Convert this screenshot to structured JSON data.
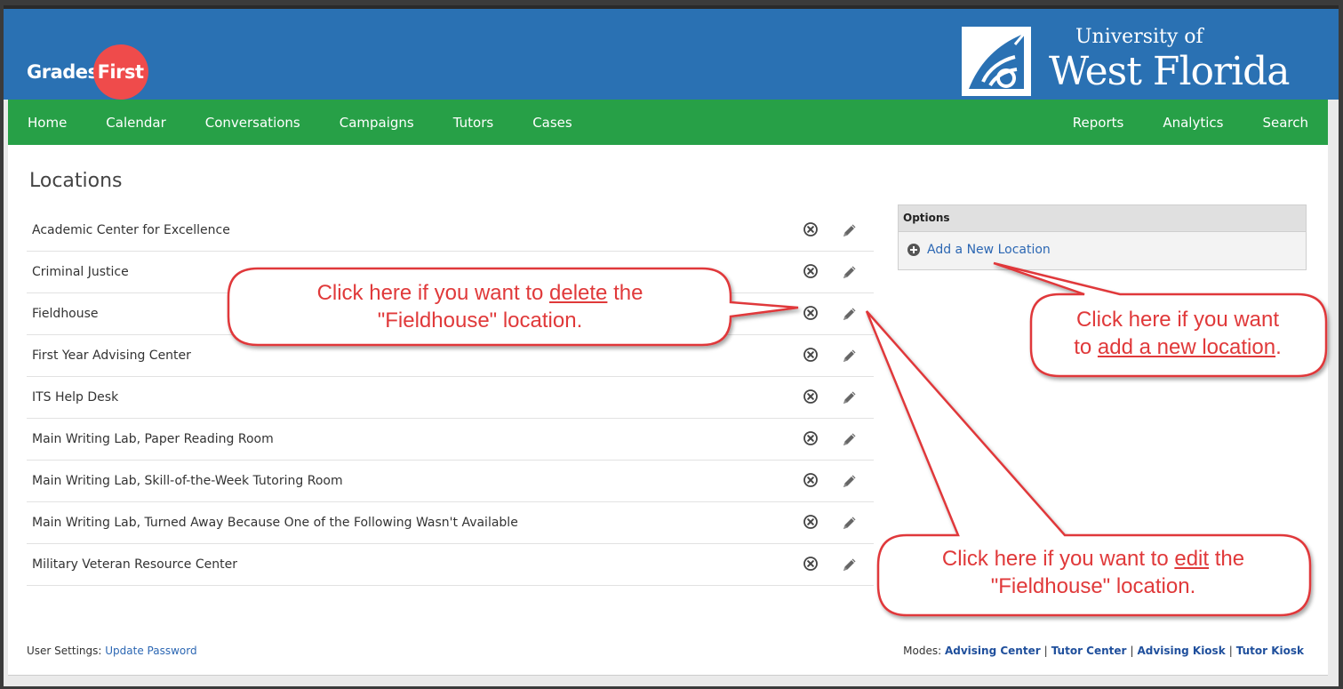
{
  "header": {
    "logo_part1": "Grades",
    "logo_part2": "First",
    "university_line1": "University of",
    "university_line2": "West Florida"
  },
  "nav": {
    "left": [
      "Home",
      "Calendar",
      "Conversations",
      "Campaigns",
      "Tutors",
      "Cases"
    ],
    "right": [
      "Reports",
      "Analytics",
      "Search"
    ]
  },
  "page": {
    "title": "Locations"
  },
  "locations": [
    "Academic Center for Excellence",
    "Criminal Justice",
    "Fieldhouse",
    "First Year Advising Center",
    "ITS Help Desk",
    "Main Writing Lab, Paper Reading Room",
    "Main Writing Lab, Skill-of-the-Week Tutoring Room",
    "Main Writing Lab, Turned Away Because One of the Following Wasn't Available",
    "Military Veteran Resource Center"
  ],
  "row_icons": {
    "delete": "close-circle-icon",
    "edit": "pencil-icon"
  },
  "options": {
    "heading": "Options",
    "add_link": "Add a New Location",
    "add_icon": "plus-circle-icon"
  },
  "footer": {
    "user_settings_label": "User Settings:",
    "update_password": "Update Password",
    "modes_label": "Modes:",
    "modes": [
      "Advising Center",
      "Tutor Center",
      "Advising Kiosk",
      "Tutor Kiosk"
    ]
  },
  "callouts": {
    "delete": {
      "before": "Click here if you want to ",
      "underlined": "delete",
      "after": " the",
      "line2": "\"Fieldhouse\" location."
    },
    "add": {
      "line1": "Click here if you want",
      "before": "to ",
      "underlined": "add a new location",
      "after": "."
    },
    "edit": {
      "before": "Click here if you want to ",
      "underlined": "edit",
      "after": " the",
      "line2": "\"Fieldhouse\" location."
    }
  },
  "colors": {
    "header_blue": "#2a71b3",
    "nav_green": "#27a047",
    "logo_red": "#ef4b4b",
    "callout_red": "#e0393a",
    "link_blue": "#2c67b3"
  }
}
